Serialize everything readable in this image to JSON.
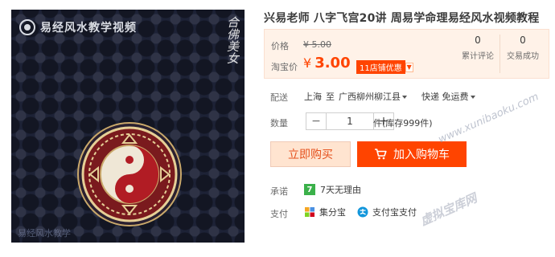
{
  "image": {
    "watermark": "易经风水教学视频",
    "calligraphy": "合佛美女",
    "bottom_text": "易经风水教学"
  },
  "product": {
    "title": "兴易老师 八字飞宫20讲 周易学命理易经风水视频教程"
  },
  "price": {
    "original_label": "价格",
    "original_value": "¥ 5.00",
    "taobao_label": "淘宝价",
    "currency": "¥",
    "taobao_value": "3.00",
    "discount_tag": "11店铺优惠"
  },
  "stats": {
    "reviews_count": "0",
    "reviews_label": "累计评论",
    "sales_count": "0",
    "sales_label": "交易成功"
  },
  "shipping": {
    "label": "配送",
    "from": "上海",
    "to_word": "至",
    "destination": "广西柳州柳江县",
    "method": "快递 免运费"
  },
  "quantity": {
    "label": "数量",
    "minus": "−",
    "value": "1",
    "plus": "+",
    "stock_text": "件(库存999件)"
  },
  "actions": {
    "buy_now": "立即购买",
    "add_to_cart": "加入购物车"
  },
  "promise": {
    "label": "承诺",
    "badge": "7",
    "text": "7天无理由"
  },
  "payment": {
    "label": "支付",
    "methods": [
      "集分宝",
      "支付宝支付"
    ]
  },
  "overlay": {
    "site_url": "www.xunibaoku.com",
    "site_name": "虚拟宝库网"
  },
  "colors": {
    "accent": "#ff4400",
    "price_bg": "#fff2e8",
    "image_bg": "#1d2236"
  }
}
